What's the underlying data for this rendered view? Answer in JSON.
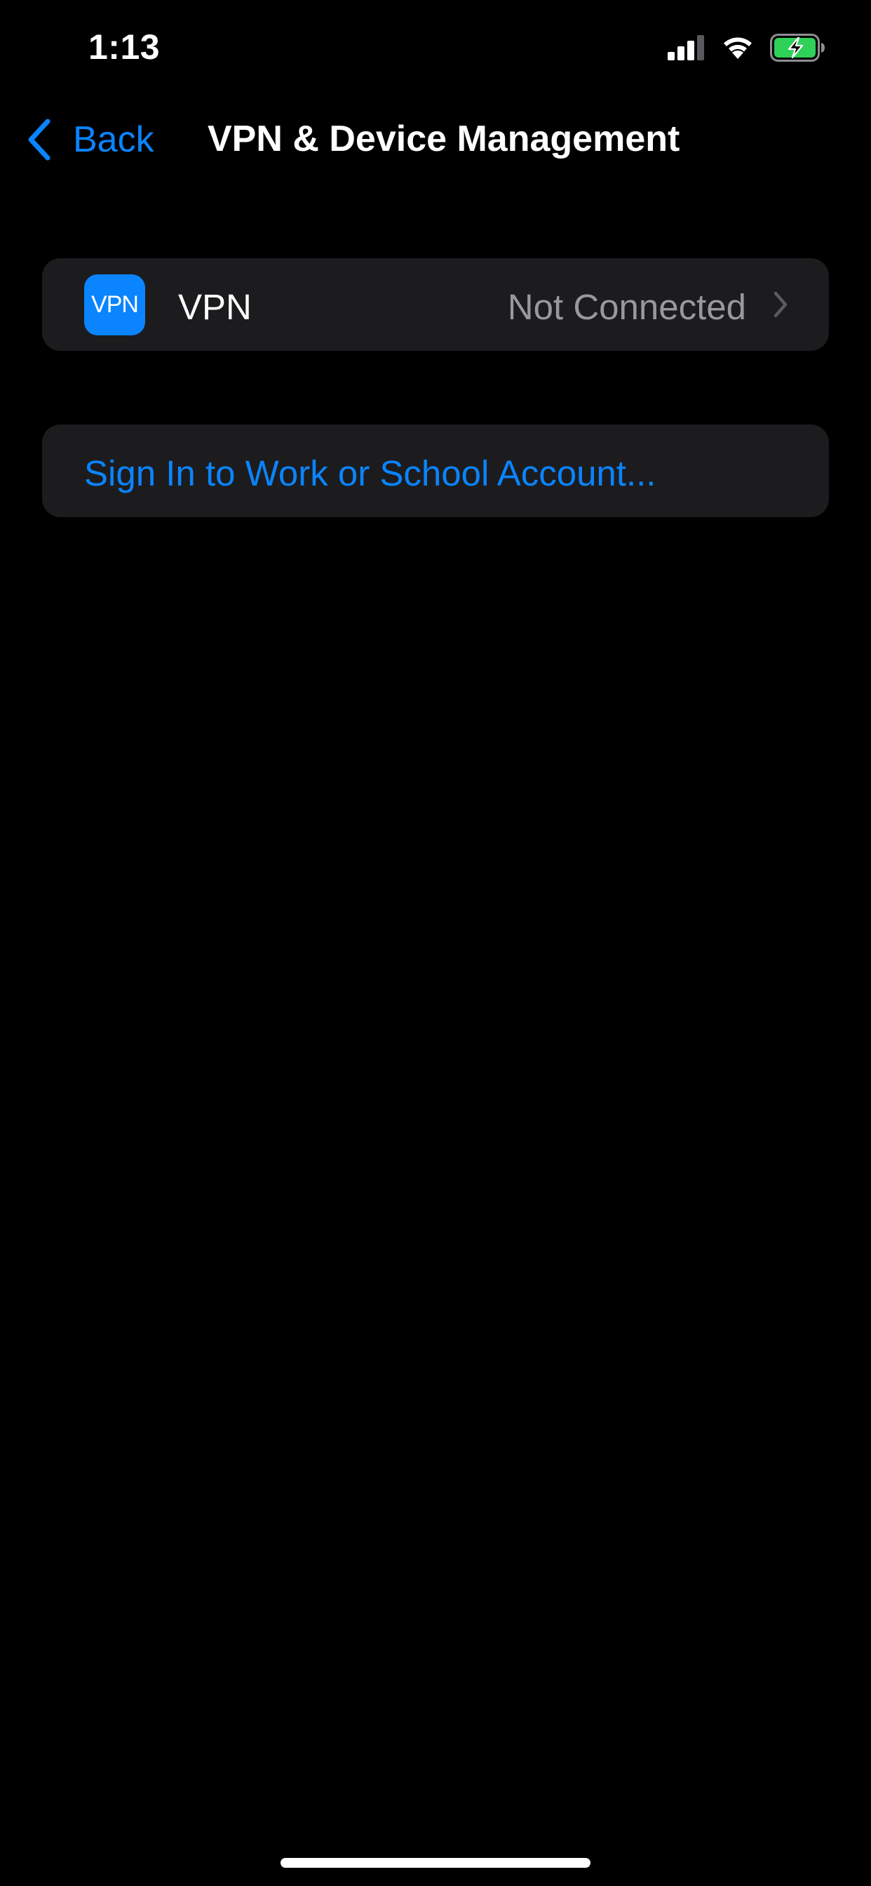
{
  "status_bar": {
    "time": "1:13",
    "signal_icon": "cellular-signal-icon",
    "wifi_icon": "wifi-icon",
    "battery_icon": "battery-charging-icon",
    "battery_color": "#30d158"
  },
  "nav": {
    "back_label": "Back",
    "title": "VPN & Device Management"
  },
  "vpn_row": {
    "badge_text": "VPN",
    "label": "VPN",
    "status": "Not Connected"
  },
  "account_row": {
    "label": "Sign In to Work or School Account..."
  },
  "colors": {
    "accent": "#0a84ff",
    "background": "#000000",
    "group_background": "#1c1c1e",
    "secondary_text": "#98989f"
  }
}
